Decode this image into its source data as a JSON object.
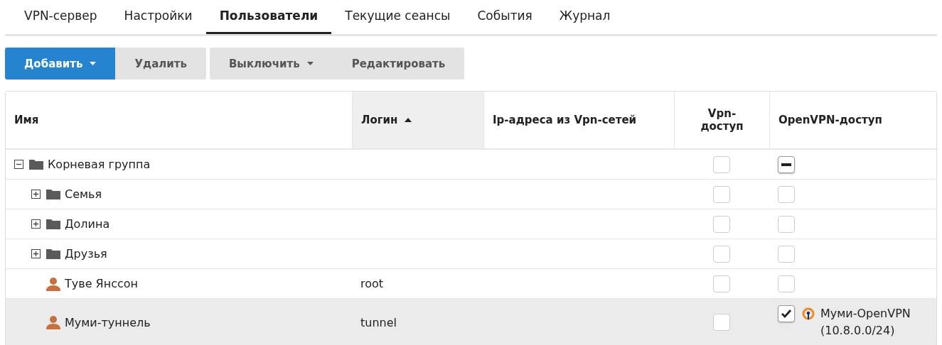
{
  "tabs": [
    {
      "label": "VPN-сервер",
      "selected": false
    },
    {
      "label": "Настройки",
      "selected": false
    },
    {
      "label": "Пользователи",
      "selected": true
    },
    {
      "label": "Текущие сеансы",
      "selected": false
    },
    {
      "label": "События",
      "selected": false
    },
    {
      "label": "Журнал",
      "selected": false
    }
  ],
  "toolbar": [
    {
      "group": [
        {
          "label": "Добавить",
          "primary": true,
          "dropdown": true
        },
        {
          "label": "Удалить",
          "primary": false,
          "dropdown": false
        }
      ]
    },
    {
      "group": [
        {
          "label": "Выключить",
          "primary": false,
          "dropdown": true
        },
        {
          "label": "Редактировать",
          "primary": false,
          "dropdown": false
        }
      ]
    }
  ],
  "table": {
    "columns": [
      {
        "label": "Имя",
        "sorted": false
      },
      {
        "label": "Логин",
        "sorted": true
      },
      {
        "label": "Ip-адреса из Vpn-сетей",
        "sorted": false
      },
      {
        "label": "Vpn-доступ",
        "sorted": false
      },
      {
        "label": "OpenVPN-доступ",
        "sorted": false
      }
    ],
    "rows": [
      {
        "kind": "group",
        "name": "Корневая группа",
        "expanded": true,
        "vpn_checked": false,
        "openvpn_checked": true,
        "openvpn_partial": true,
        "selected": false,
        "children": [
          {
            "kind": "group",
            "name": "Семья",
            "expanded": false,
            "vpn_checked": false,
            "openvpn_checked": false,
            "selected": false
          },
          {
            "kind": "group",
            "name": "Долина",
            "expanded": false,
            "vpn_checked": false,
            "openvpn_checked": false,
            "selected": false
          },
          {
            "kind": "group",
            "name": "Друзья",
            "expanded": false,
            "vpn_checked": false,
            "openvpn_checked": false,
            "selected": false
          },
          {
            "kind": "user",
            "name": "Туве Янссон",
            "login": "root",
            "vpn_checked": false,
            "openvpn_checked": false,
            "selected": false
          },
          {
            "kind": "user",
            "name": "Муми-туннель",
            "login": "tunnel",
            "vpn_checked": false,
            "openvpn_checked": true,
            "openvpn_server": "Муми-OpenVPN (10.8.0.0/24)",
            "selected": true
          }
        ]
      }
    ]
  }
}
